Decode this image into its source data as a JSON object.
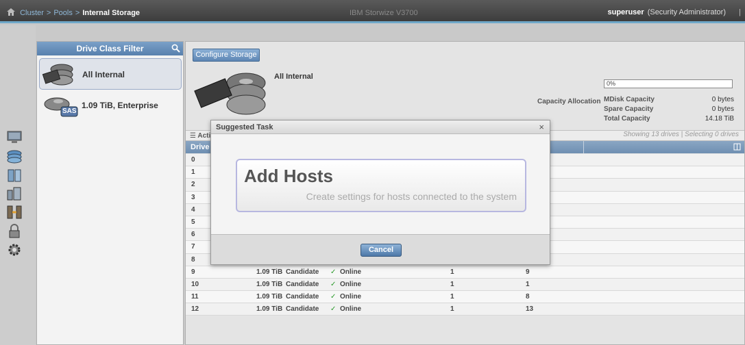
{
  "topbar": {
    "crumbs": [
      "Cluster",
      "Pools",
      "Internal Storage"
    ],
    "product": "IBM Storwize V3700",
    "user": "superuser",
    "role": "(Security Administrator)"
  },
  "filter": {
    "title": "Drive Class Filter",
    "items": [
      {
        "label": "All Internal",
        "selected": true
      },
      {
        "label": "1.09 TiB, Enterprise",
        "badge": "SAS"
      }
    ]
  },
  "main": {
    "configure_button": "Configure Storage",
    "heading": "All Internal",
    "capacity_allocation_label": "Capacity Allocation",
    "capacity_percent": "0%",
    "capacity_rows": [
      {
        "k": "MDisk Capacity",
        "v": "0 bytes"
      },
      {
        "k": "Spare Capacity",
        "v": "0 bytes"
      },
      {
        "k": "Total Capacity",
        "v": "14.18 TiB"
      }
    ],
    "showing": "Showing 13 drives | Selecting 0 drives",
    "actions_label": "Acti",
    "col0_header": "Drive",
    "rows": [
      {
        "id": "0"
      },
      {
        "id": "1"
      },
      {
        "id": "2"
      },
      {
        "id": "3"
      },
      {
        "id": "4"
      },
      {
        "id": "5"
      },
      {
        "id": "6"
      },
      {
        "id": "7"
      },
      {
        "id": "8"
      },
      {
        "id": "9",
        "cap": "1.09 TiB",
        "use": "Candidate",
        "status": "Online",
        "m": "1",
        "s": "9"
      },
      {
        "id": "10",
        "cap": "1.09 TiB",
        "use": "Candidate",
        "status": "Online",
        "m": "1",
        "s": "1"
      },
      {
        "id": "11",
        "cap": "1.09 TiB",
        "use": "Candidate",
        "status": "Online",
        "m": "1",
        "s": "8"
      },
      {
        "id": "12",
        "cap": "1.09 TiB",
        "use": "Candidate",
        "status": "Online",
        "m": "1",
        "s": "13"
      }
    ]
  },
  "modal": {
    "title": "Suggested Task",
    "close": "×",
    "task_title": "Add Hosts",
    "task_desc": "Create settings for hosts connected to the system",
    "cancel": "Cancel"
  },
  "colors": {
    "accent": "#6fa8c9",
    "header_blue": "#5880ad",
    "ok_green": "#2a9a2a"
  }
}
